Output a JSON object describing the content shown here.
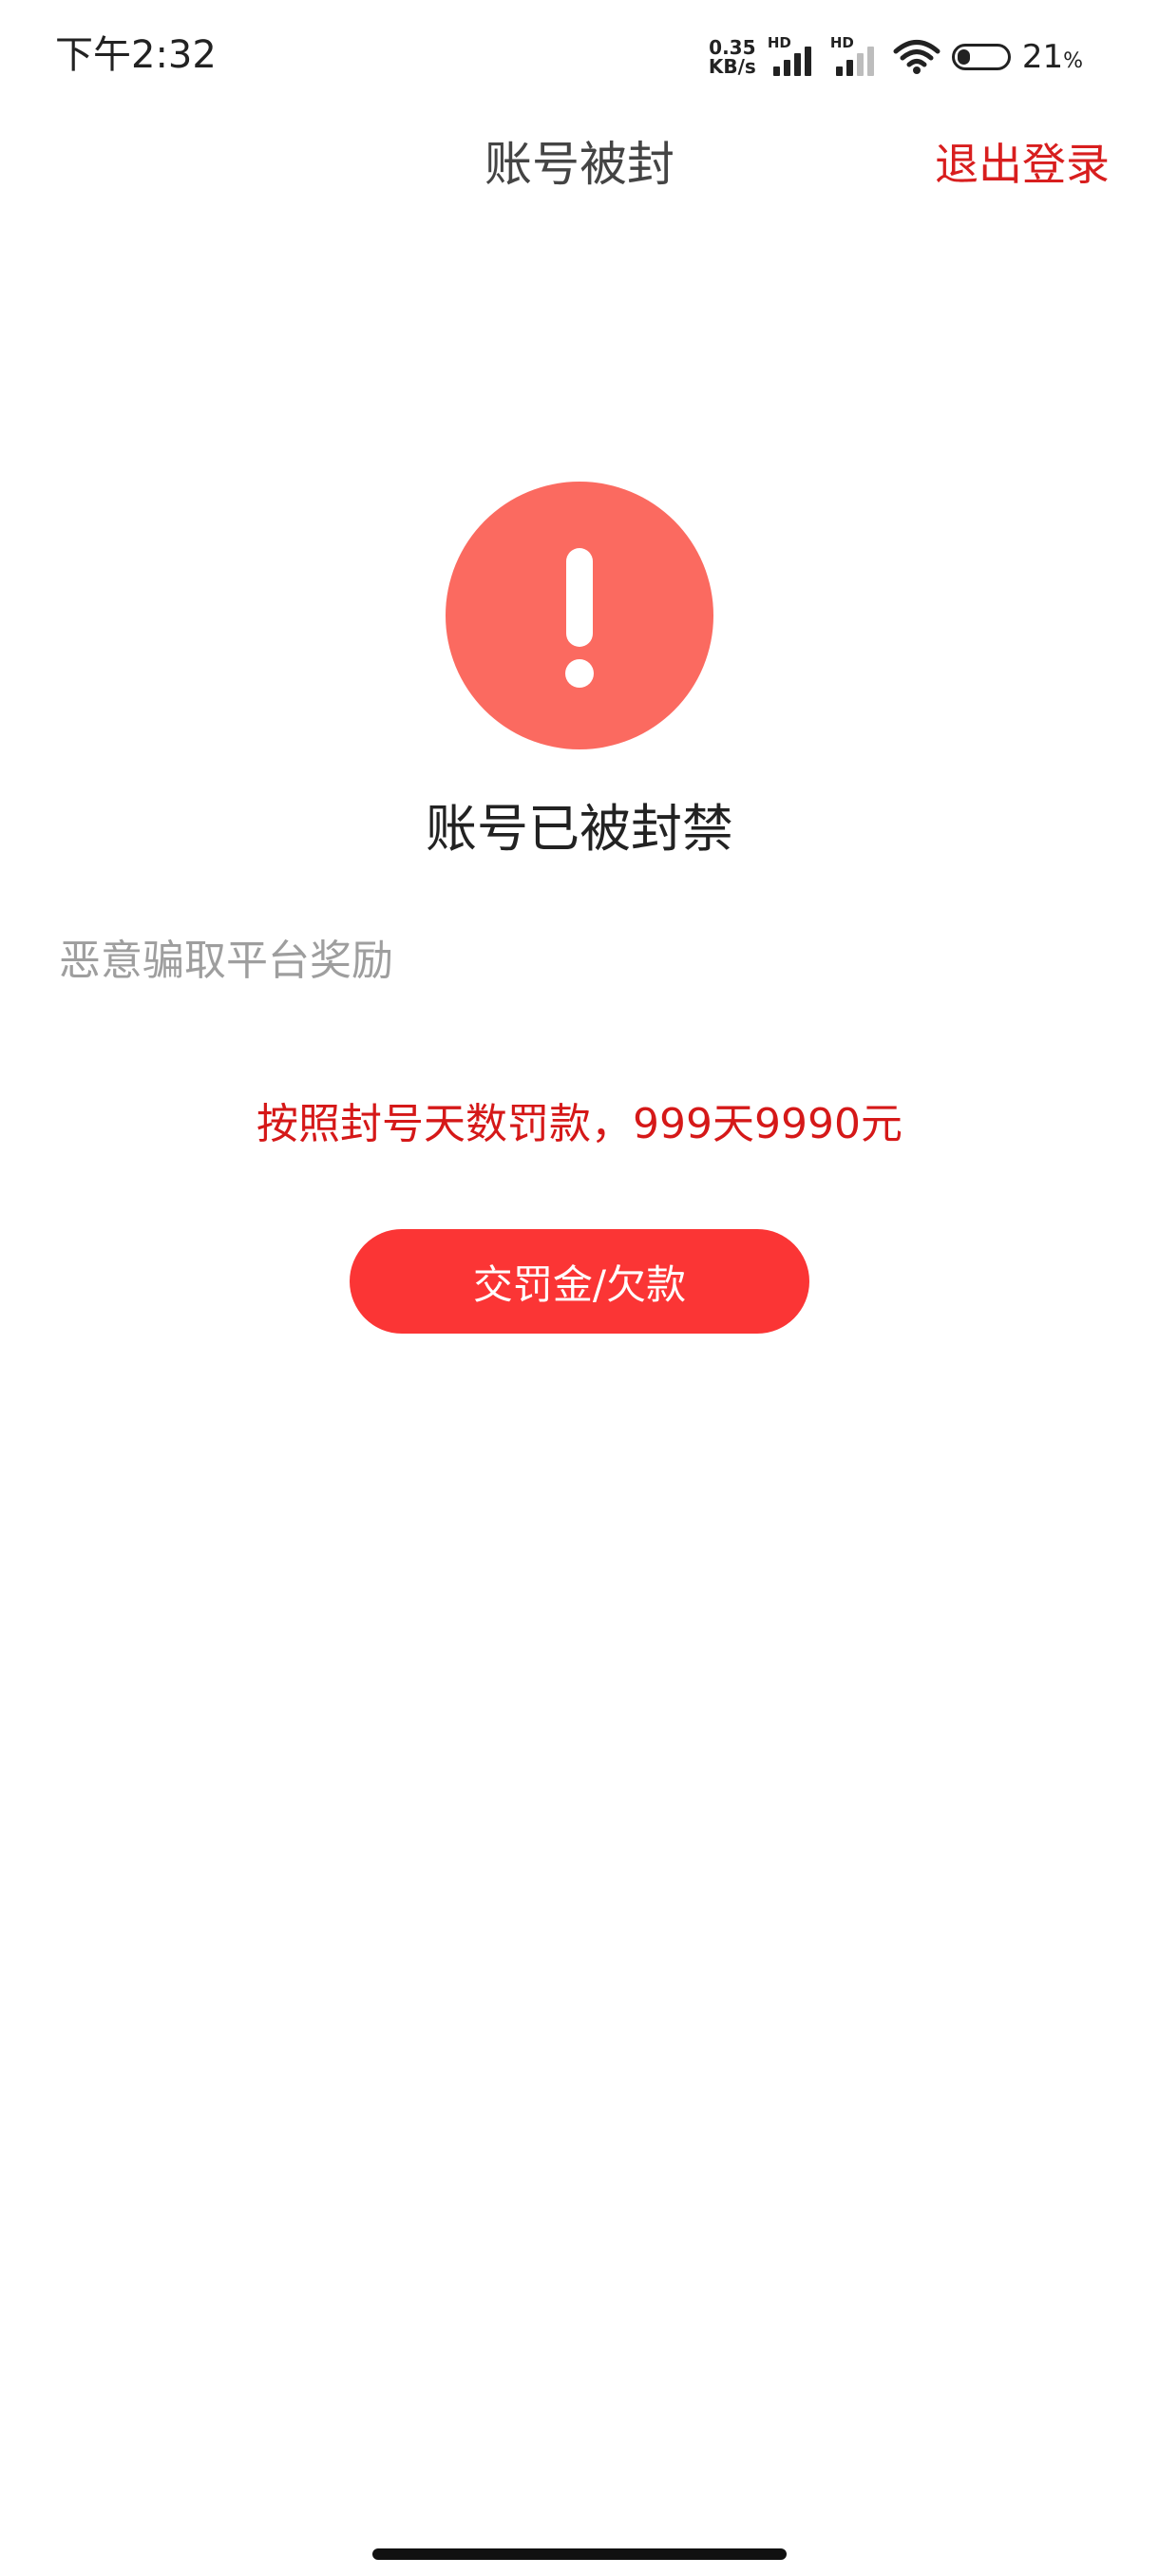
{
  "status_bar": {
    "time": "下午2:32",
    "net_speed_value": "0.35",
    "net_speed_unit": "KB/s",
    "sim1_label": "HD",
    "sim2_label": "HD",
    "battery_value": "21",
    "battery_unit": "%"
  },
  "nav": {
    "title": "账号被封",
    "logout_label": "退出登录"
  },
  "main": {
    "banned_title": "账号已被封禁",
    "reason": "恶意骗取平台奖励",
    "fine_text": "按照封号天数罚款，999天9990元",
    "pay_button_label": "交罚金/欠款"
  },
  "colors": {
    "accent_red": "#d51818",
    "button_red": "#fb3535",
    "warning_circle": "#fb6a60"
  },
  "icons": {
    "warning": "exclamation-circle-icon",
    "wifi": "wifi-icon",
    "battery": "battery-icon",
    "signal": "signal-icon"
  }
}
